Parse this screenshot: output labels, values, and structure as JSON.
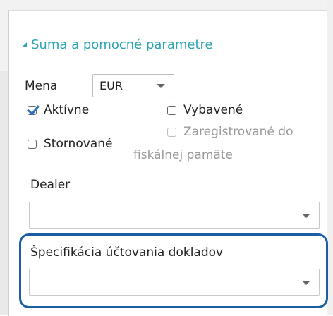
{
  "section": {
    "title": "Suma a pomocné parametre",
    "icon": "triangle-expand-icon"
  },
  "currency": {
    "label": "Mena",
    "value": "EUR"
  },
  "checkboxes": {
    "active": {
      "label": "Aktívne",
      "checked": true
    },
    "equipped": {
      "label": "Vybavené",
      "checked": false
    },
    "cancelled": {
      "label": "Stornované",
      "checked": false
    },
    "fiscal": {
      "label_line1": "Zaregistrované do",
      "label_line2": "fiskálnej pamäte",
      "checked": false,
      "disabled": true
    }
  },
  "dealer": {
    "label": "Dealer",
    "value": ""
  },
  "billing_spec": {
    "label": "Špecifikácia účtovania dokladov",
    "value": ""
  },
  "colors": {
    "accent": "#2ba3b3",
    "highlight": "#1a5ea3",
    "check": "#2d6fbf"
  }
}
